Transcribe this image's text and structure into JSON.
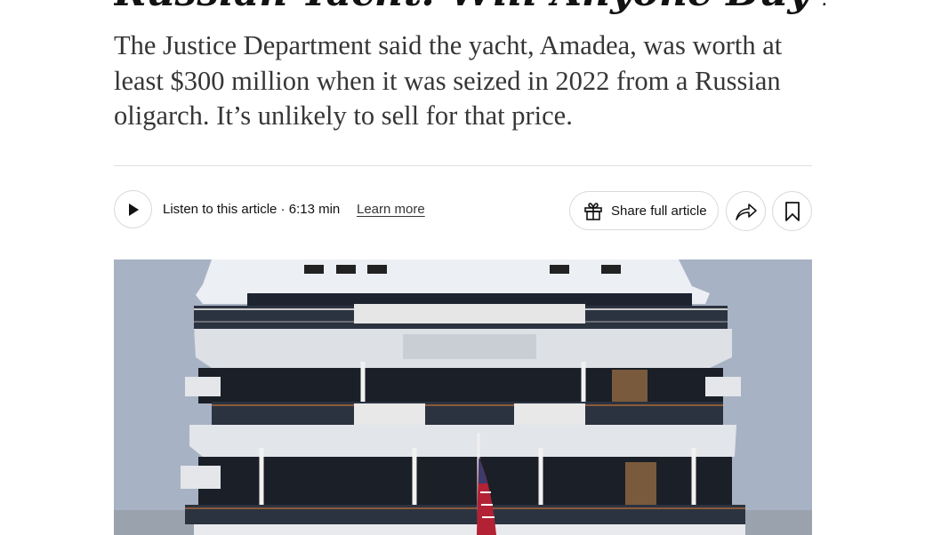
{
  "article": {
    "headline": "Russian Yacht: Will Anyone Buy It?",
    "summary": "The Justice Department said the yacht, Amadea, was worth at least $300 million when it was seized in 2022 from a Russian oligarch. It’s unlikely to sell for that price."
  },
  "audio": {
    "play_icon": "play-icon",
    "listen_label": "Listen to this article · 6:13 min",
    "learn_more_label": "Learn more"
  },
  "toolbar": {
    "share_full_label": "Share full article",
    "gift_icon": "gift-icon",
    "share_icon": "share-arrow-icon",
    "save_icon": "bookmark-icon"
  },
  "colors": {
    "text": "#121212",
    "summary_text": "#363636",
    "border": "#d9d9d9",
    "sky": "#a7b2c4"
  }
}
